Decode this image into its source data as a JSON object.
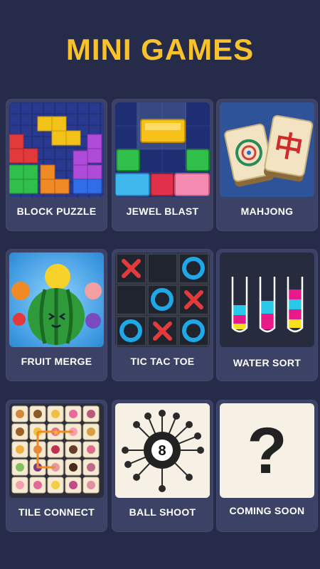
{
  "header": {
    "title": "MINI GAMES"
  },
  "colors": {
    "background": "#262b4a",
    "card": "#3b4266",
    "title": "#f7c22c"
  },
  "games": [
    {
      "label": "BLOCK PUZZLE",
      "icon": "block-puzzle-icon"
    },
    {
      "label": "JEWEL BLAST",
      "icon": "jewel-blast-icon"
    },
    {
      "label": "MAHJONG",
      "icon": "mahjong-tiles-icon",
      "tile_glyph": "中"
    },
    {
      "label": "FRUIT MERGE",
      "icon": "fruit-merge-icon"
    },
    {
      "label": "TIC TAC TOE",
      "icon": "tic-tac-toe-icon"
    },
    {
      "label": "WATER SORT",
      "icon": "water-sort-icon"
    },
    {
      "label": "TILE CONNECT",
      "icon": "tile-connect-icon"
    },
    {
      "label": "BALL SHOOT",
      "icon": "ball-shoot-icon",
      "ball_number": "8"
    },
    {
      "label": "COMING SOON",
      "icon": "question-mark-icon",
      "glyph": "?"
    }
  ]
}
